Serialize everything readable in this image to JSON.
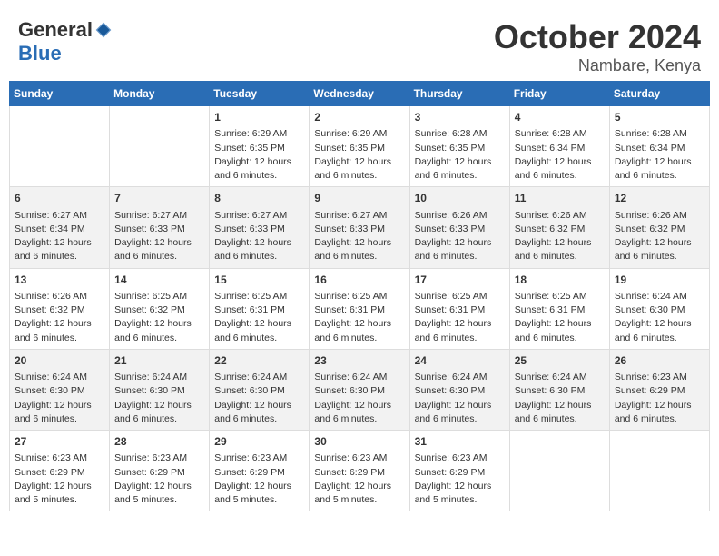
{
  "header": {
    "logo_general": "General",
    "logo_blue": "Blue",
    "month": "October 2024",
    "location": "Nambare, Kenya"
  },
  "days_of_week": [
    "Sunday",
    "Monday",
    "Tuesday",
    "Wednesday",
    "Thursday",
    "Friday",
    "Saturday"
  ],
  "weeks": [
    [
      {
        "day": "",
        "info": ""
      },
      {
        "day": "",
        "info": ""
      },
      {
        "day": "1",
        "info": "Sunrise: 6:29 AM\nSunset: 6:35 PM\nDaylight: 12 hours and 6 minutes."
      },
      {
        "day": "2",
        "info": "Sunrise: 6:29 AM\nSunset: 6:35 PM\nDaylight: 12 hours and 6 minutes."
      },
      {
        "day": "3",
        "info": "Sunrise: 6:28 AM\nSunset: 6:35 PM\nDaylight: 12 hours and 6 minutes."
      },
      {
        "day": "4",
        "info": "Sunrise: 6:28 AM\nSunset: 6:34 PM\nDaylight: 12 hours and 6 minutes."
      },
      {
        "day": "5",
        "info": "Sunrise: 6:28 AM\nSunset: 6:34 PM\nDaylight: 12 hours and 6 minutes."
      }
    ],
    [
      {
        "day": "6",
        "info": "Sunrise: 6:27 AM\nSunset: 6:34 PM\nDaylight: 12 hours and 6 minutes."
      },
      {
        "day": "7",
        "info": "Sunrise: 6:27 AM\nSunset: 6:33 PM\nDaylight: 12 hours and 6 minutes."
      },
      {
        "day": "8",
        "info": "Sunrise: 6:27 AM\nSunset: 6:33 PM\nDaylight: 12 hours and 6 minutes."
      },
      {
        "day": "9",
        "info": "Sunrise: 6:27 AM\nSunset: 6:33 PM\nDaylight: 12 hours and 6 minutes."
      },
      {
        "day": "10",
        "info": "Sunrise: 6:26 AM\nSunset: 6:33 PM\nDaylight: 12 hours and 6 minutes."
      },
      {
        "day": "11",
        "info": "Sunrise: 6:26 AM\nSunset: 6:32 PM\nDaylight: 12 hours and 6 minutes."
      },
      {
        "day": "12",
        "info": "Sunrise: 6:26 AM\nSunset: 6:32 PM\nDaylight: 12 hours and 6 minutes."
      }
    ],
    [
      {
        "day": "13",
        "info": "Sunrise: 6:26 AM\nSunset: 6:32 PM\nDaylight: 12 hours and 6 minutes."
      },
      {
        "day": "14",
        "info": "Sunrise: 6:25 AM\nSunset: 6:32 PM\nDaylight: 12 hours and 6 minutes."
      },
      {
        "day": "15",
        "info": "Sunrise: 6:25 AM\nSunset: 6:31 PM\nDaylight: 12 hours and 6 minutes."
      },
      {
        "day": "16",
        "info": "Sunrise: 6:25 AM\nSunset: 6:31 PM\nDaylight: 12 hours and 6 minutes."
      },
      {
        "day": "17",
        "info": "Sunrise: 6:25 AM\nSunset: 6:31 PM\nDaylight: 12 hours and 6 minutes."
      },
      {
        "day": "18",
        "info": "Sunrise: 6:25 AM\nSunset: 6:31 PM\nDaylight: 12 hours and 6 minutes."
      },
      {
        "day": "19",
        "info": "Sunrise: 6:24 AM\nSunset: 6:30 PM\nDaylight: 12 hours and 6 minutes."
      }
    ],
    [
      {
        "day": "20",
        "info": "Sunrise: 6:24 AM\nSunset: 6:30 PM\nDaylight: 12 hours and 6 minutes."
      },
      {
        "day": "21",
        "info": "Sunrise: 6:24 AM\nSunset: 6:30 PM\nDaylight: 12 hours and 6 minutes."
      },
      {
        "day": "22",
        "info": "Sunrise: 6:24 AM\nSunset: 6:30 PM\nDaylight: 12 hours and 6 minutes."
      },
      {
        "day": "23",
        "info": "Sunrise: 6:24 AM\nSunset: 6:30 PM\nDaylight: 12 hours and 6 minutes."
      },
      {
        "day": "24",
        "info": "Sunrise: 6:24 AM\nSunset: 6:30 PM\nDaylight: 12 hours and 6 minutes."
      },
      {
        "day": "25",
        "info": "Sunrise: 6:24 AM\nSunset: 6:30 PM\nDaylight: 12 hours and 6 minutes."
      },
      {
        "day": "26",
        "info": "Sunrise: 6:23 AM\nSunset: 6:29 PM\nDaylight: 12 hours and 6 minutes."
      }
    ],
    [
      {
        "day": "27",
        "info": "Sunrise: 6:23 AM\nSunset: 6:29 PM\nDaylight: 12 hours and 5 minutes."
      },
      {
        "day": "28",
        "info": "Sunrise: 6:23 AM\nSunset: 6:29 PM\nDaylight: 12 hours and 5 minutes."
      },
      {
        "day": "29",
        "info": "Sunrise: 6:23 AM\nSunset: 6:29 PM\nDaylight: 12 hours and 5 minutes."
      },
      {
        "day": "30",
        "info": "Sunrise: 6:23 AM\nSunset: 6:29 PM\nDaylight: 12 hours and 5 minutes."
      },
      {
        "day": "31",
        "info": "Sunrise: 6:23 AM\nSunset: 6:29 PM\nDaylight: 12 hours and 5 minutes."
      },
      {
        "day": "",
        "info": ""
      },
      {
        "day": "",
        "info": ""
      }
    ]
  ]
}
